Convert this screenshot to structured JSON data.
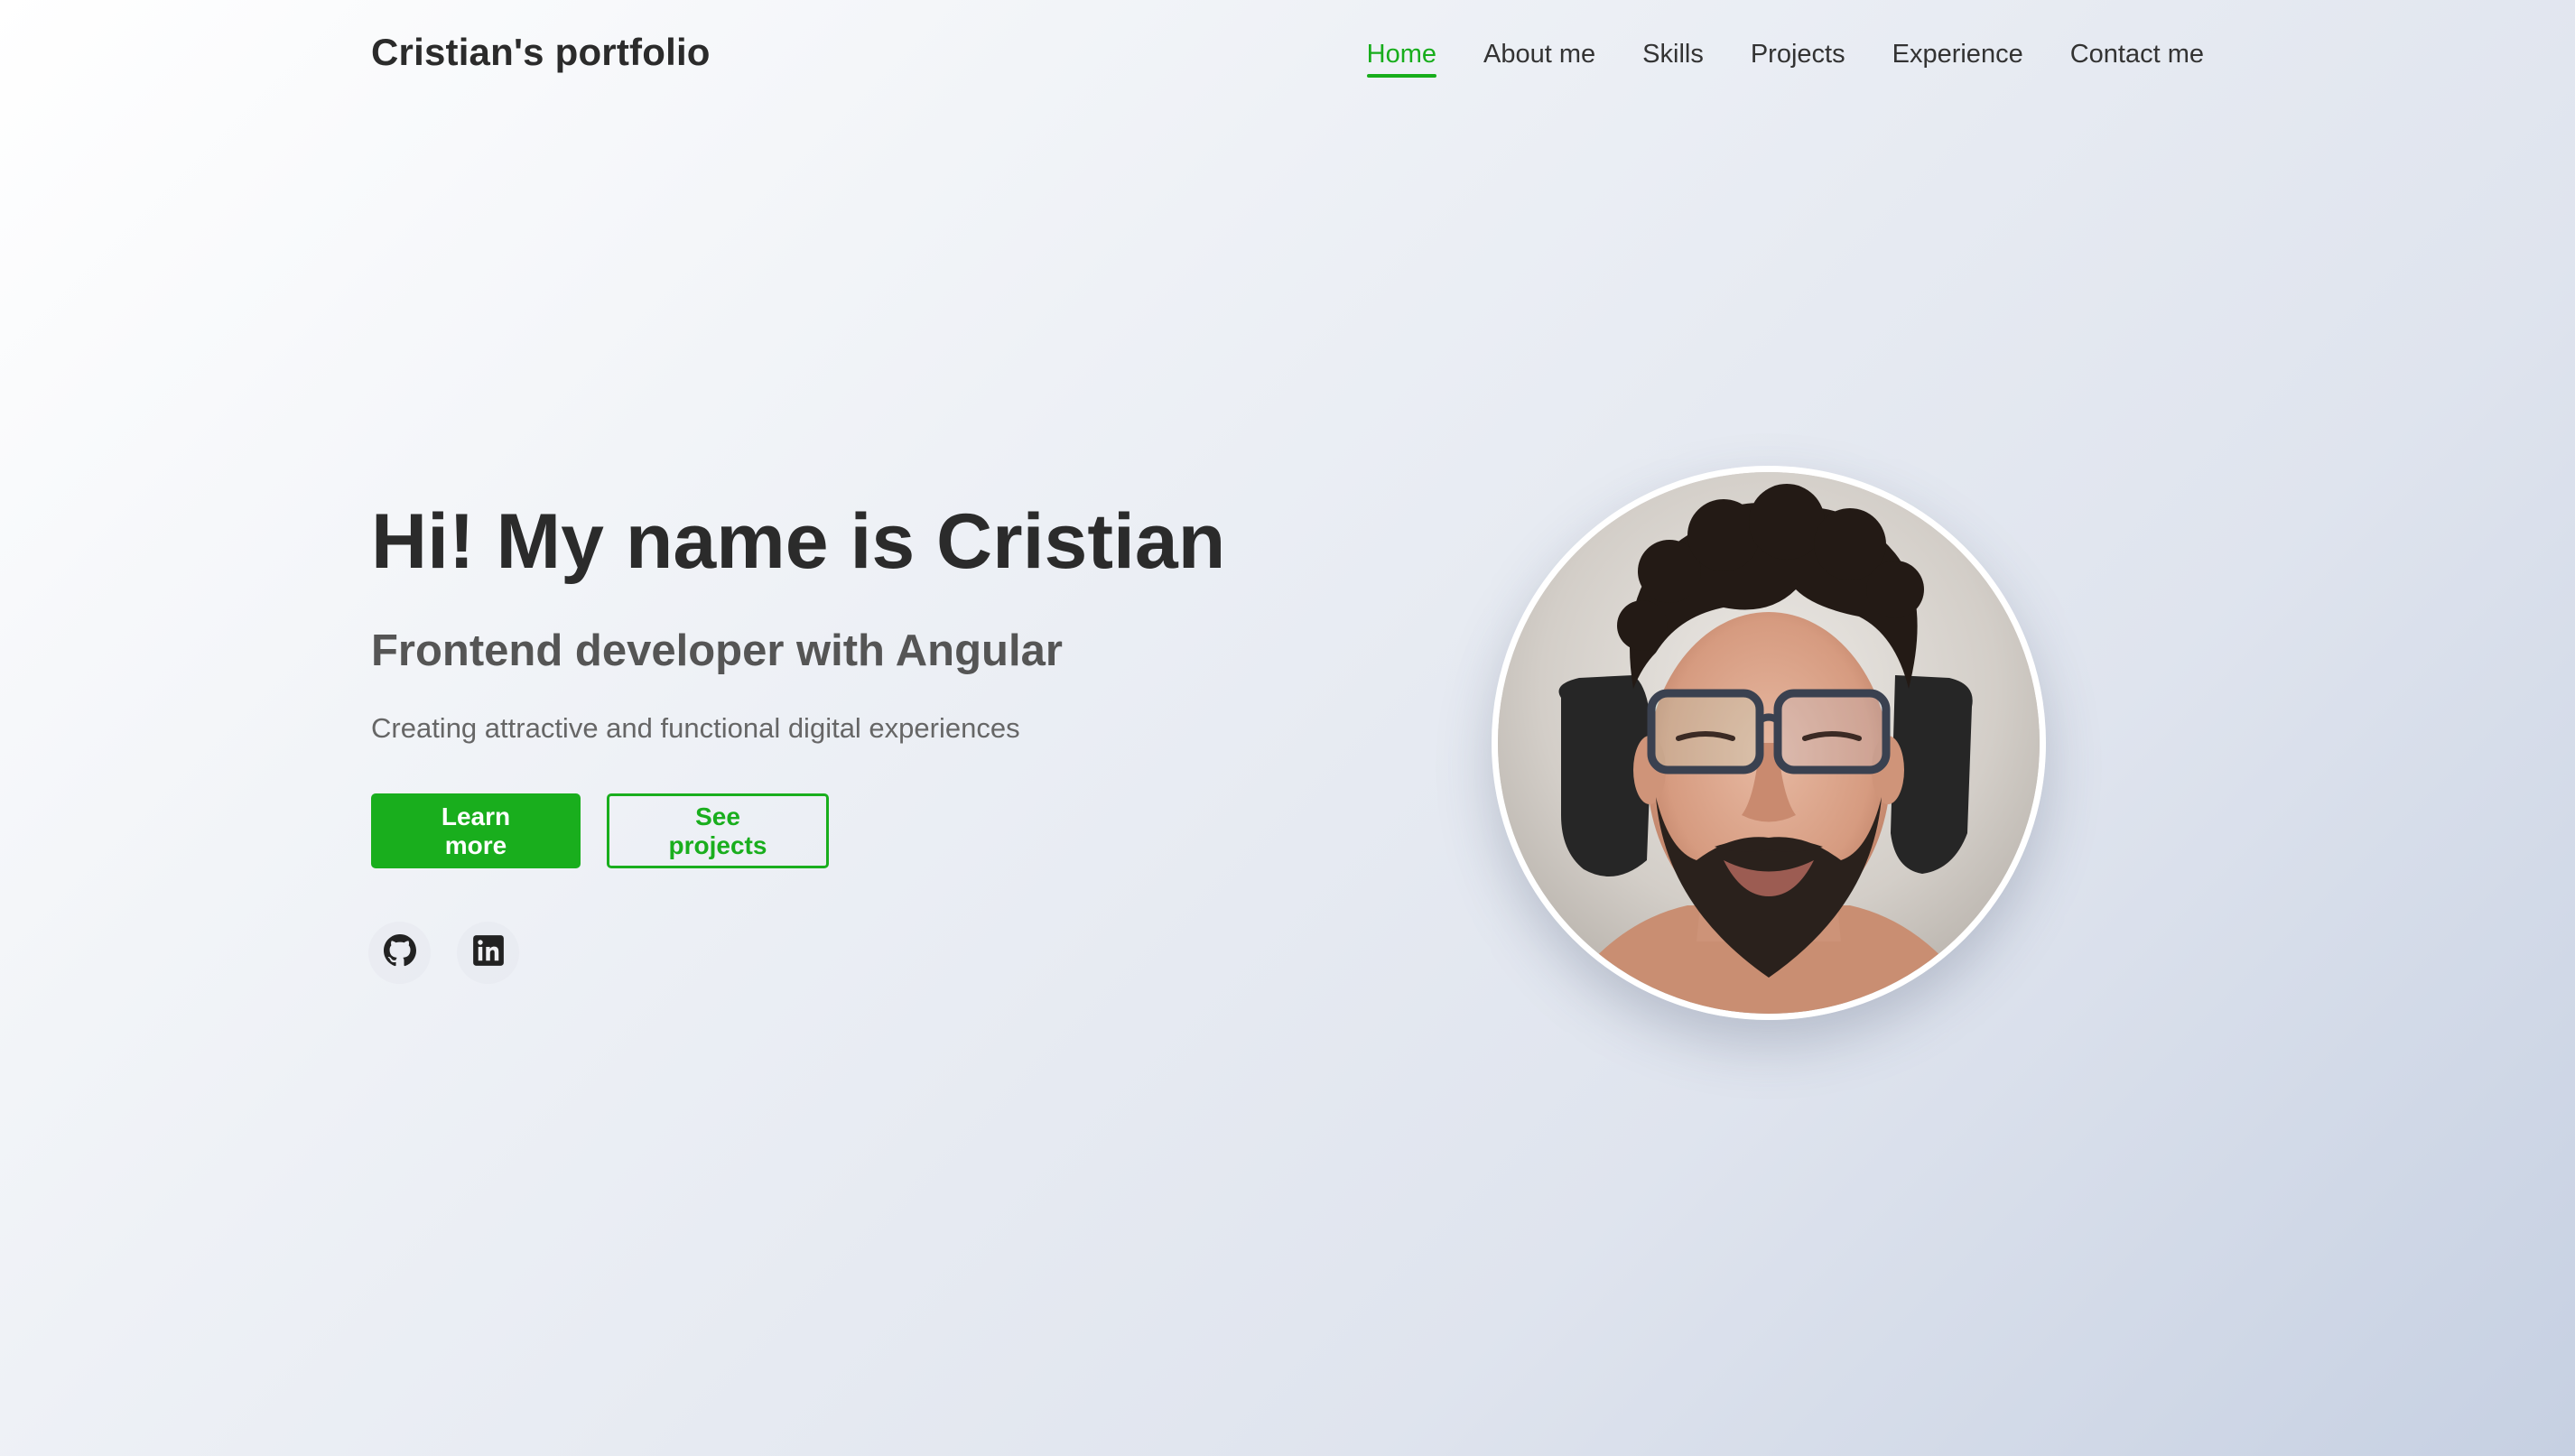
{
  "header": {
    "brand": "Cristian's portfolio",
    "nav": [
      {
        "label": "Home",
        "active": true
      },
      {
        "label": "About me",
        "active": false
      },
      {
        "label": "Skills",
        "active": false
      },
      {
        "label": "Projects",
        "active": false
      },
      {
        "label": "Experience",
        "active": false
      },
      {
        "label": "Contact me",
        "active": false
      }
    ]
  },
  "hero": {
    "title": "Hi! My name is Cristian",
    "subtitle": "Frontend developer with Angular",
    "description": "Creating attractive and functional digital experiences",
    "primary_button": "Learn more",
    "secondary_button": "See projects",
    "social": [
      {
        "icon": "github-icon"
      },
      {
        "icon": "linkedin-icon"
      }
    ]
  },
  "profile_photo": {
    "icon": "profile-photo"
  },
  "colors": {
    "accent": "#19ae1d",
    "text_dark": "#2b2b2b",
    "text_muted": "#666666"
  }
}
